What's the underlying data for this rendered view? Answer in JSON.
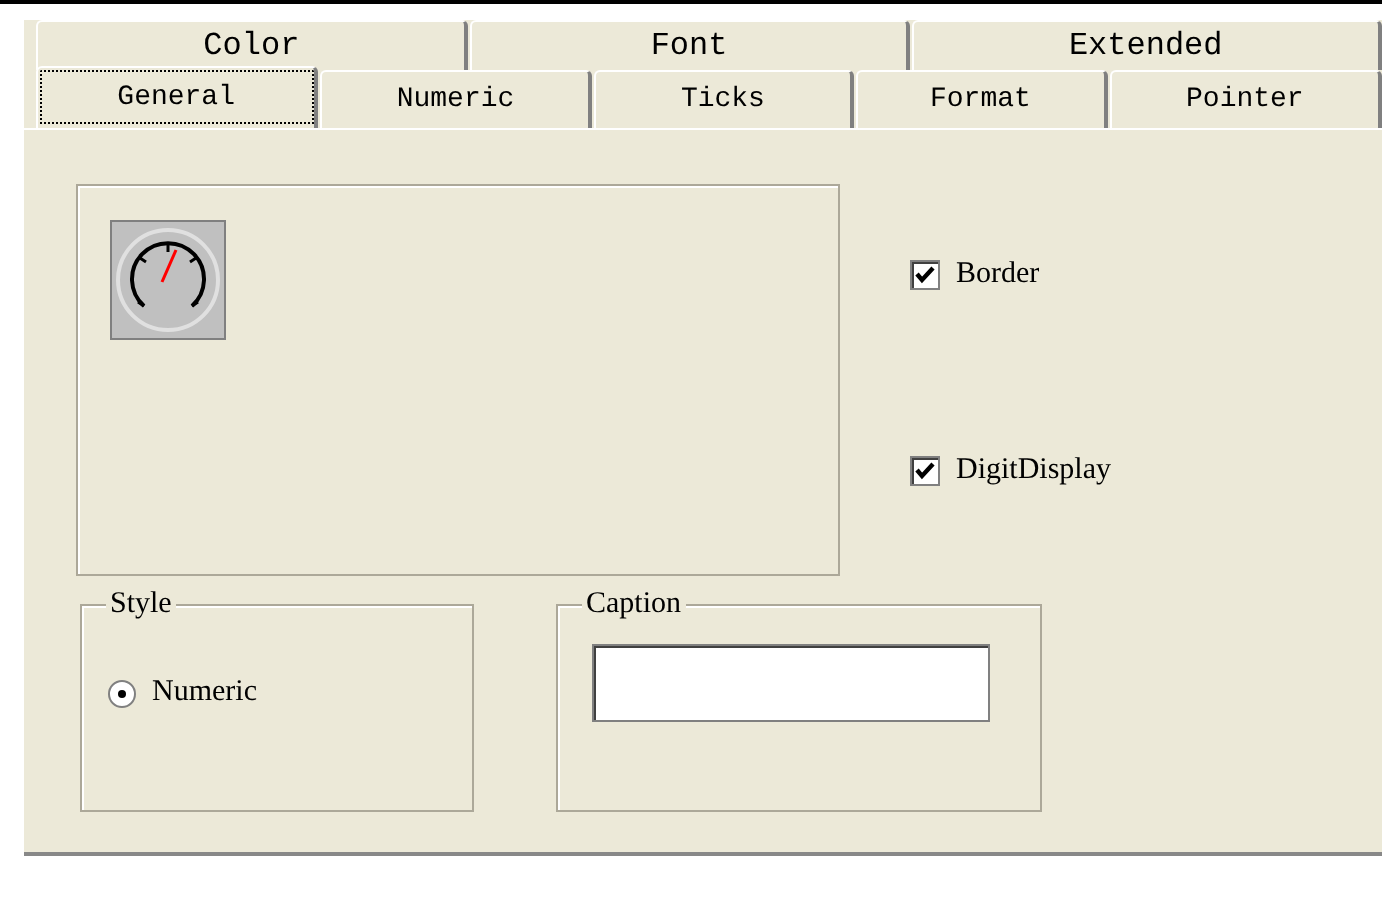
{
  "tab_rows": [
    {
      "tabs": [
        {
          "label": "Color",
          "selected": false
        },
        {
          "label": "Font",
          "selected": false
        },
        {
          "label": "Extended",
          "selected": false
        }
      ]
    },
    {
      "tabs": [
        {
          "label": "General",
          "selected": true
        },
        {
          "label": "Numeric",
          "selected": false
        },
        {
          "label": "Ticks",
          "selected": false
        },
        {
          "label": "Format",
          "selected": false
        },
        {
          "label": "Pointer",
          "selected": false
        }
      ]
    }
  ],
  "options": [
    {
      "label": "Border",
      "checked": true
    },
    {
      "label": "DigitDisplay",
      "checked": true
    }
  ],
  "style_group": {
    "title": "Style",
    "radios": [
      {
        "label": "Numeric",
        "selected": true
      }
    ]
  },
  "caption_group": {
    "title": "Caption"
  }
}
